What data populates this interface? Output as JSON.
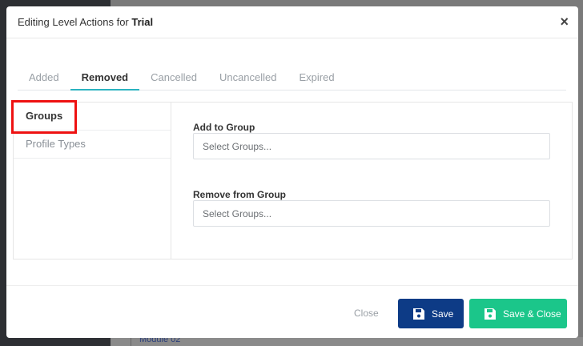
{
  "modal": {
    "title_prefix": "Editing Level Actions for ",
    "title_name": "Trial",
    "close_symbol": "×"
  },
  "tabs": [
    {
      "label": "Added"
    },
    {
      "label": "Removed",
      "active": true
    },
    {
      "label": "Cancelled"
    },
    {
      "label": "Uncancelled"
    },
    {
      "label": "Expired"
    }
  ],
  "sidebar": {
    "items": [
      {
        "label": "Groups",
        "active": true
      },
      {
        "label": "Profile Types"
      }
    ]
  },
  "form": {
    "add_label": "Add to Group",
    "add_placeholder": "Select Groups...",
    "remove_label": "Remove from Group",
    "remove_placeholder": "Select Groups..."
  },
  "footer": {
    "close_label": "Close",
    "save_label": "Save",
    "save_close_label": "Save & Close"
  },
  "background": {
    "module_label": "Module 02"
  },
  "colors": {
    "accent_tab": "#2bb3c0",
    "save_button": "#0d3b86",
    "save_close_button": "#1bc68a",
    "highlight": "#ee1111"
  },
  "icons": {
    "close": "close-icon",
    "save": "floppy-disk-icon"
  }
}
